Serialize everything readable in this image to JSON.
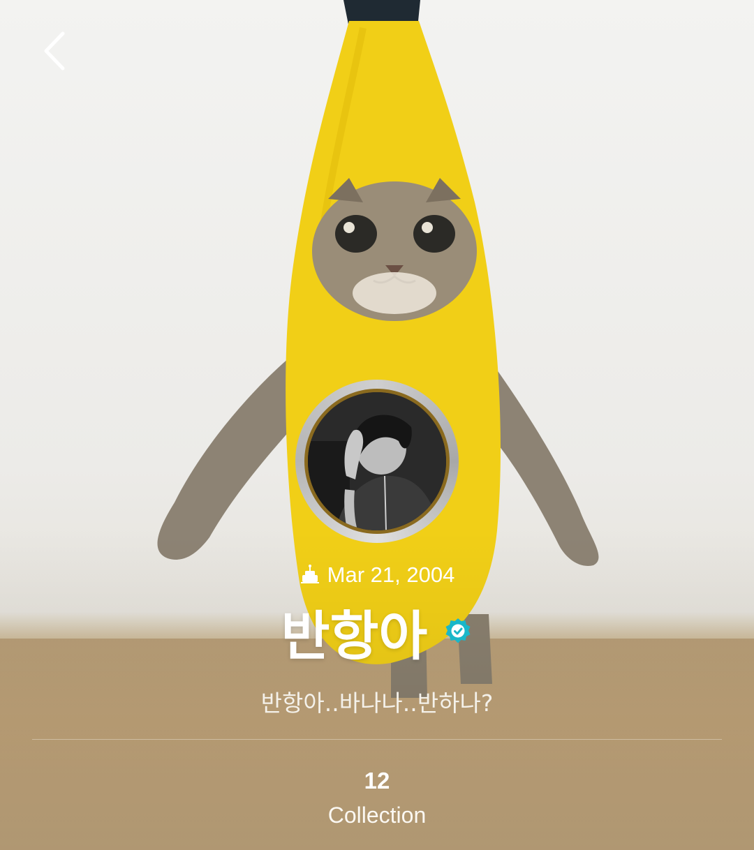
{
  "header": {
    "back_icon": "chevron-left-icon"
  },
  "profile": {
    "birthday_icon": "cake-icon",
    "birthday": "Mar 21, 2004",
    "name": "반항아",
    "verified_icon": "verified-badge-icon",
    "bio": "반항아..바나나..반하나?"
  },
  "stats": [
    {
      "count": "12",
      "label": "Collection"
    }
  ],
  "colors": {
    "verified": "#19b7c9",
    "banana": "#f3d21b",
    "text": "#ffffff"
  }
}
